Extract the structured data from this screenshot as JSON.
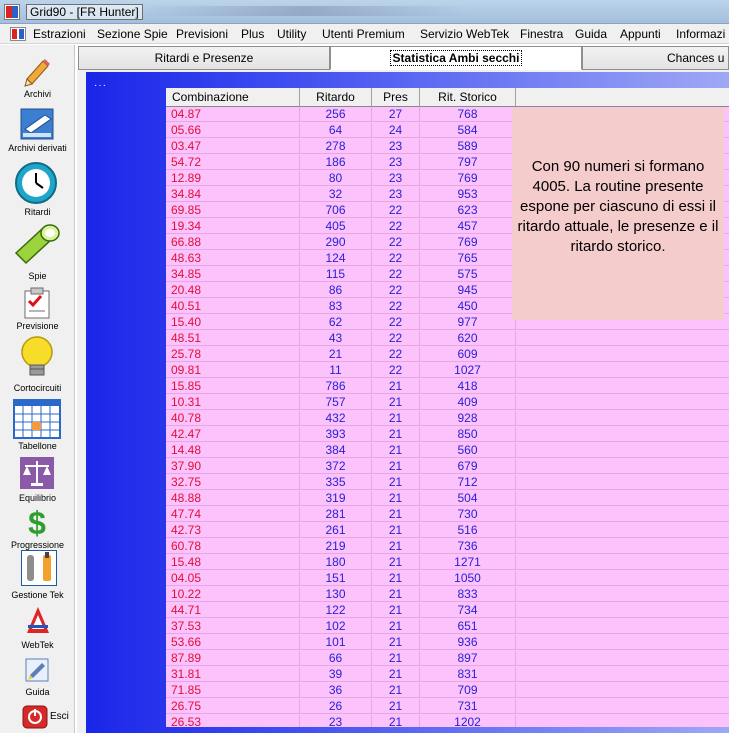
{
  "window": {
    "title": "Grid90 - [FR Hunter]"
  },
  "menu": [
    "Estrazioni",
    "Sezione Spie",
    "Previsioni",
    "Plus",
    "Utility",
    "Utenti Premium",
    "Servizio WebTek",
    "Finestra",
    "Guida",
    "Appunti",
    "Informazi"
  ],
  "toolbar": [
    {
      "label": "Archivi",
      "icon": "pencil-icon"
    },
    {
      "label": "Archivi derivati",
      "icon": "book-icon"
    },
    {
      "label": "Ritardi",
      "icon": "clock-icon"
    },
    {
      "label": "Spie",
      "icon": "flashlight-icon"
    },
    {
      "label": "Previsione",
      "icon": "checklist-icon"
    },
    {
      "label": "Cortocircuiti",
      "icon": "lightbulb-icon"
    },
    {
      "label": "Tabellone",
      "icon": "grid-icon"
    },
    {
      "label": "Equilibrio",
      "icon": "balance-icon"
    },
    {
      "label": "Progressione",
      "icon": "dollar-icon"
    },
    {
      "label": "Gestione Tek",
      "icon": "tools-icon"
    },
    {
      "label": "WebTek",
      "icon": "webtek-icon"
    },
    {
      "label": "Guida",
      "icon": "guide-icon"
    },
    {
      "label": "Esci",
      "icon": "power-icon"
    }
  ],
  "tabs": [
    {
      "label": "Ritardi e Presenze",
      "active": false
    },
    {
      "label": "Statistica Ambi secchi",
      "active": true
    },
    {
      "label": "Chances u",
      "active": false
    }
  ],
  "grid": {
    "dots": "···",
    "columns": [
      "Combinazione",
      "Ritardo",
      "Pres",
      "Rit. Storico"
    ],
    "rows": [
      [
        "04.87",
        "256",
        "27",
        "768"
      ],
      [
        "05.66",
        "64",
        "24",
        "584"
      ],
      [
        "03.47",
        "278",
        "23",
        "589"
      ],
      [
        "54.72",
        "186",
        "23",
        "797"
      ],
      [
        "12.89",
        "80",
        "23",
        "769"
      ],
      [
        "34.84",
        "32",
        "23",
        "953"
      ],
      [
        "69.85",
        "706",
        "22",
        "623"
      ],
      [
        "19.34",
        "405",
        "22",
        "457"
      ],
      [
        "66.88",
        "290",
        "22",
        "769"
      ],
      [
        "48.63",
        "124",
        "22",
        "765"
      ],
      [
        "34.85",
        "115",
        "22",
        "575"
      ],
      [
        "20.48",
        "86",
        "22",
        "945"
      ],
      [
        "40.51",
        "83",
        "22",
        "450"
      ],
      [
        "15.40",
        "62",
        "22",
        "977"
      ],
      [
        "48.51",
        "43",
        "22",
        "620"
      ],
      [
        "25.78",
        "21",
        "22",
        "609"
      ],
      [
        "09.81",
        "11",
        "22",
        "1027"
      ],
      [
        "15.85",
        "786",
        "21",
        "418"
      ],
      [
        "10.31",
        "757",
        "21",
        "409"
      ],
      [
        "40.78",
        "432",
        "21",
        "928"
      ],
      [
        "42.47",
        "393",
        "21",
        "850"
      ],
      [
        "14.48",
        "384",
        "21",
        "560"
      ],
      [
        "37.90",
        "372",
        "21",
        "679"
      ],
      [
        "32.75",
        "335",
        "21",
        "712"
      ],
      [
        "48.88",
        "319",
        "21",
        "504"
      ],
      [
        "47.74",
        "281",
        "21",
        "730"
      ],
      [
        "42.73",
        "261",
        "21",
        "516"
      ],
      [
        "60.78",
        "219",
        "21",
        "736"
      ],
      [
        "15.48",
        "180",
        "21",
        "1271"
      ],
      [
        "04.05",
        "151",
        "21",
        "1050"
      ],
      [
        "10.22",
        "130",
        "21",
        "833"
      ],
      [
        "44.71",
        "122",
        "21",
        "734"
      ],
      [
        "37.53",
        "102",
        "21",
        "651"
      ],
      [
        "53.66",
        "101",
        "21",
        "936"
      ],
      [
        "87.89",
        "66",
        "21",
        "897"
      ],
      [
        "31.81",
        "39",
        "21",
        "831"
      ],
      [
        "71.85",
        "36",
        "21",
        "709"
      ],
      [
        "26.75",
        "26",
        "21",
        "731"
      ],
      [
        "26.53",
        "23",
        "21",
        "1202"
      ]
    ]
  },
  "note": {
    "text": "Con 90 numeri si formano 4005. La routine presente espone per ciascuno di essi il ritardo attuale, le presenze e il ritardo storico."
  },
  "colors": {
    "combination_text": "#e0103a",
    "value_text": "#2b20d6",
    "grid_background": "#fbc2fb",
    "note_background": "#f4cccc"
  }
}
